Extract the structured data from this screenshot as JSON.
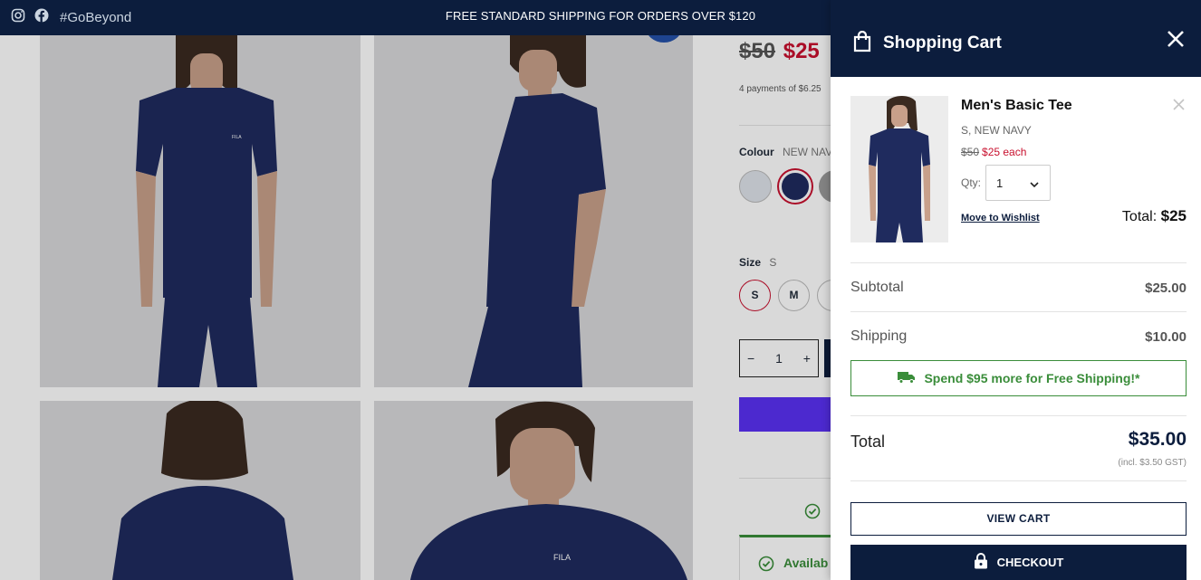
{
  "topbar": {
    "hashtag": "#GoBeyond",
    "promo": "FREE STANDARD SHIPPING FOR ORDERS OVER $120",
    "icons": [
      "instagram-icon",
      "facebook-icon"
    ]
  },
  "product": {
    "old_price": "$50",
    "new_price": "$25",
    "payments_text": "4 payments of $6.25",
    "colour_label": "Colour",
    "colour_value": "NEW NAVY",
    "size_label": "Size",
    "size_value": "S",
    "sizes": [
      "S",
      "M"
    ],
    "qty": "1",
    "availability": "Availab"
  },
  "cart": {
    "title": "Shopping Cart",
    "item": {
      "name": "Men's Basic Tee",
      "variant": "S, NEW NAVY",
      "old_price": "$50",
      "new_price": "$25 each",
      "qty_label": "Qty:",
      "qty": "1",
      "wishlist": "Move to Wishlist",
      "total_label": "Total:",
      "total": "$25"
    },
    "subtotal_label": "Subtotal",
    "subtotal": "$25.00",
    "shipping_label": "Shipping",
    "shipping": "$10.00",
    "free_shipping_msg": "Spend $95 more for Free Shipping!*",
    "total_label": "Total",
    "total": "$35.00",
    "gst": "(incl. $3.50 GST)",
    "view_cart": "VIEW CART",
    "checkout": "CHECKOUT"
  },
  "colors": {
    "navy": "#0c1d3d",
    "sale_red": "#c8102e",
    "success_green": "#3a8d3a",
    "paypal_purple": "#5a31f4"
  }
}
